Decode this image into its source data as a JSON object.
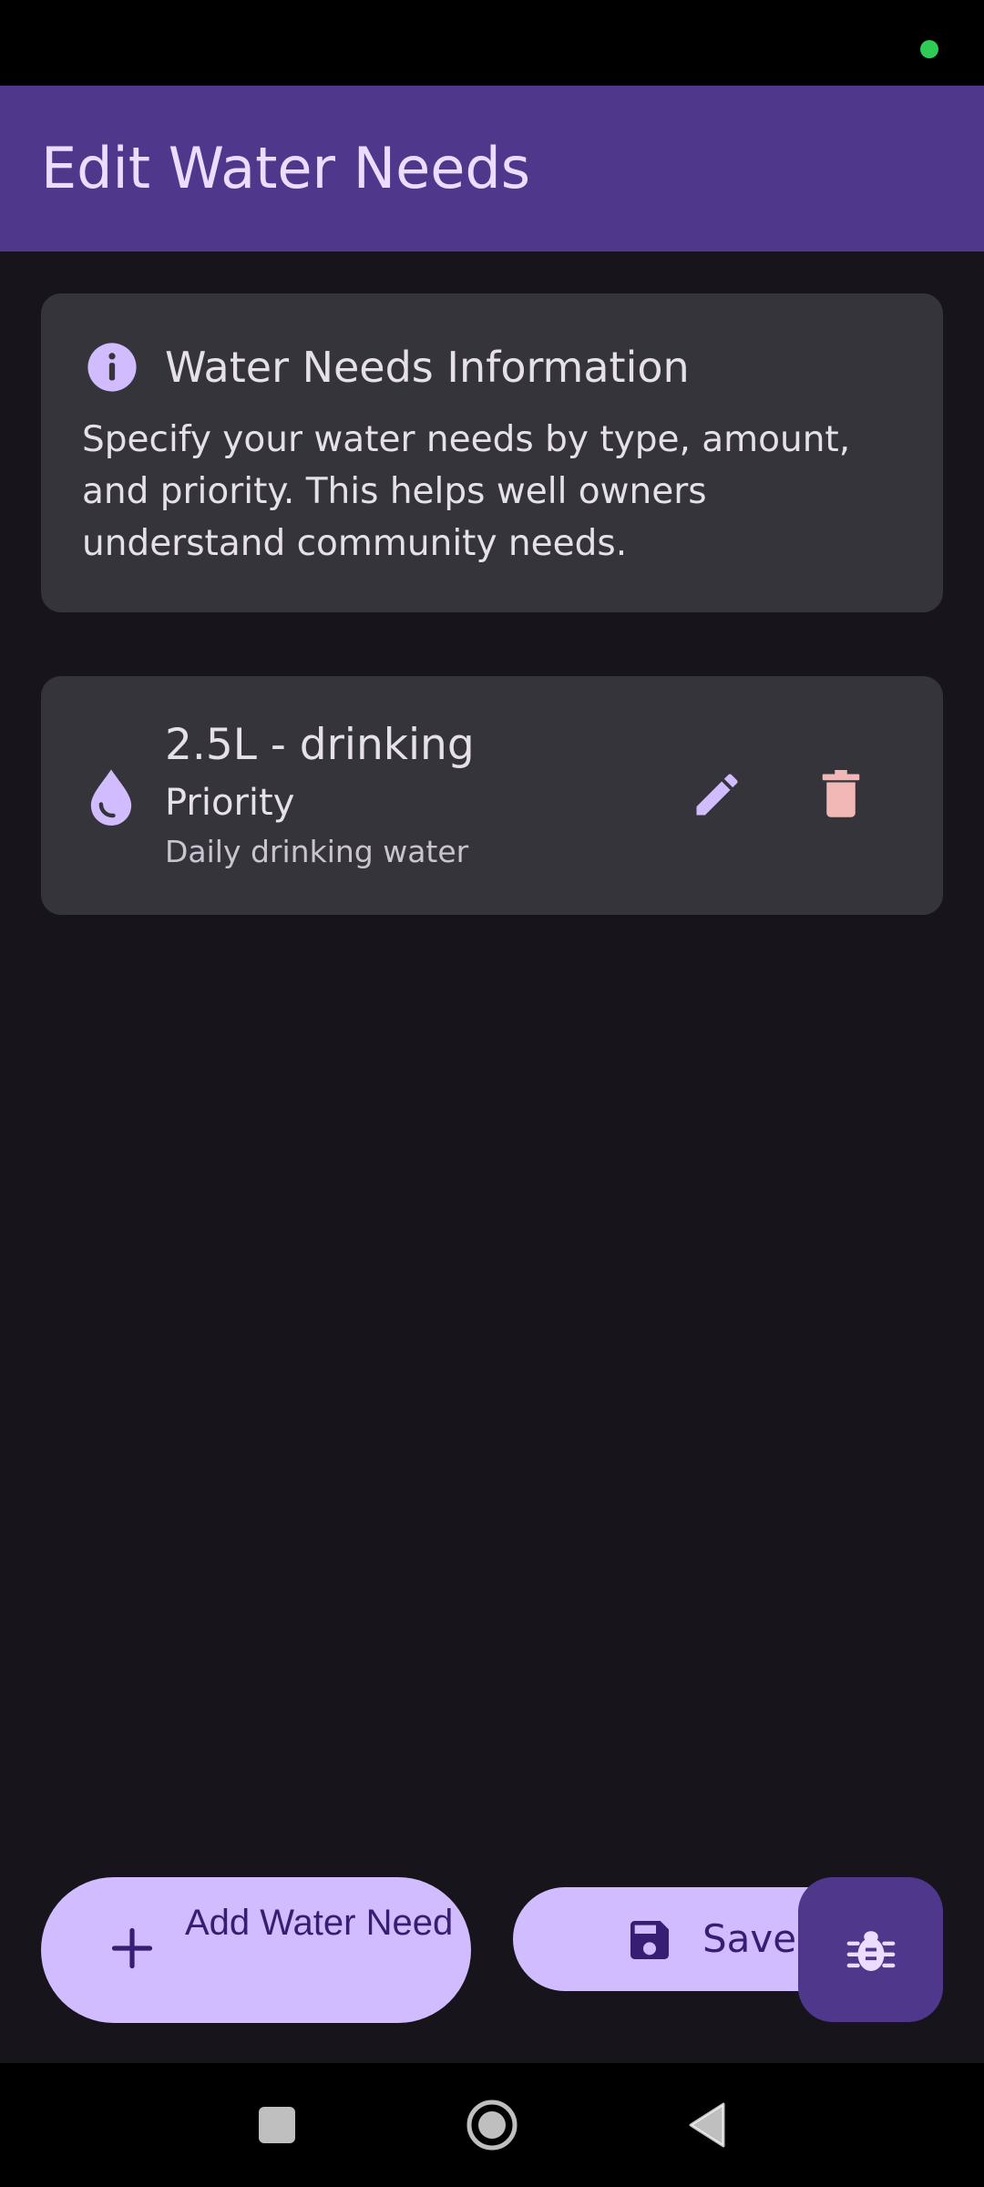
{
  "colors": {
    "app_bar": "#4f378b",
    "background": "#17151b",
    "card": "#36343b",
    "accent": "#d0bcff",
    "on_accent": "#381e72",
    "delete": "#f2b8b5",
    "status_dot": "#2ecc55"
  },
  "app_bar": {
    "title": "Edit Water Needs"
  },
  "info_card": {
    "icon": "info-icon",
    "title": "Water Needs Information",
    "body": "Specify your water needs by type, amount, and priority. This helps well owners understand community needs."
  },
  "water_needs": [
    {
      "icon": "water-drop-icon",
      "title": "2.5L - drinking",
      "priority": "Priority",
      "note": "Daily drinking water",
      "edit_icon": "edit-icon",
      "delete_icon": "delete-icon"
    }
  ],
  "fabs": {
    "add_label": "Add Water Need",
    "add_icon": "plus-icon",
    "save_label": "Save All",
    "save_icon": "save-icon",
    "debug_icon": "bug-icon"
  },
  "nav_bar": {
    "recents_icon": "square-icon",
    "home_icon": "home-circle-icon",
    "back_icon": "back-triangle-icon"
  }
}
